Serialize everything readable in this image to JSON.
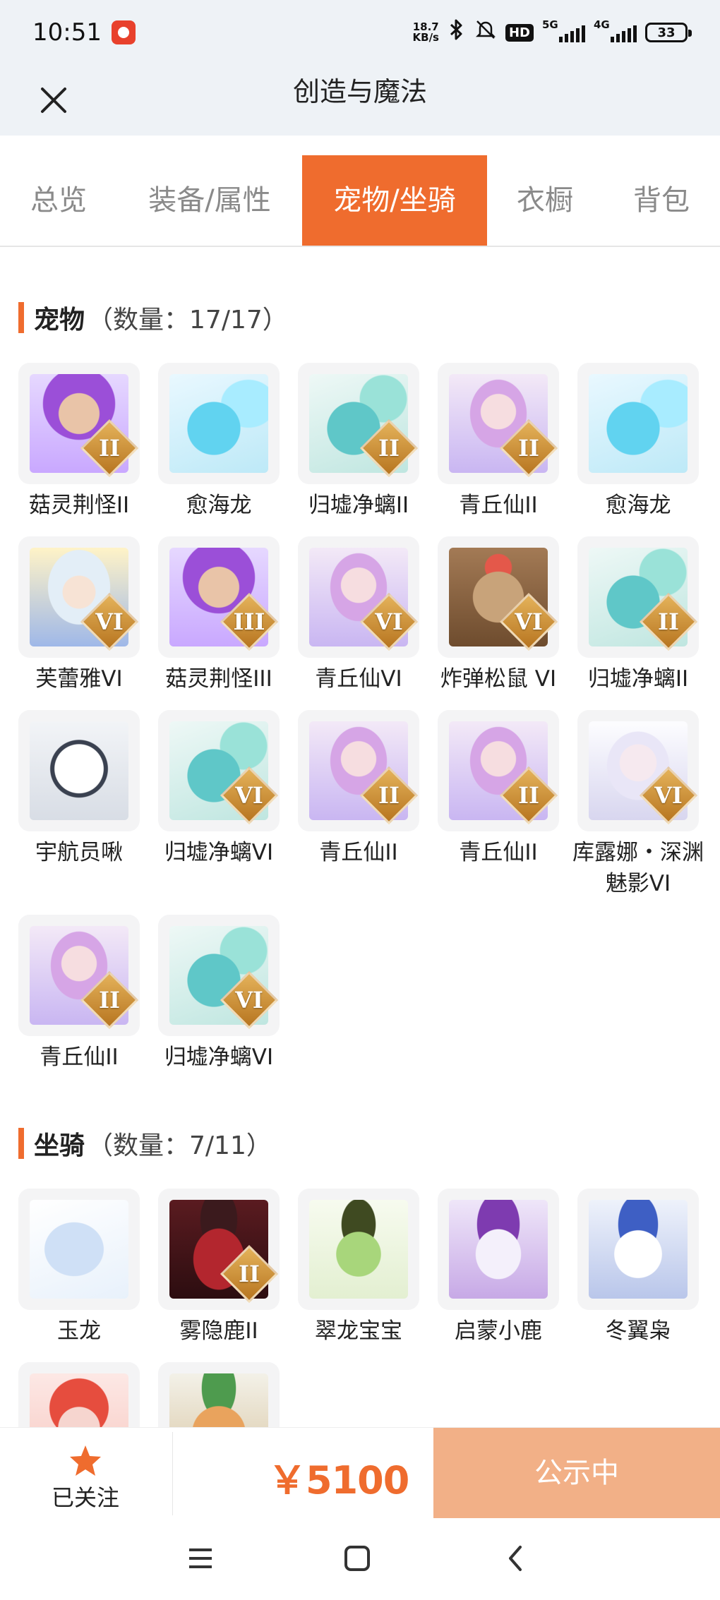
{
  "status_bar": {
    "time": "10:51",
    "net_speed_value": "18.7",
    "net_speed_unit": "KB/s",
    "hd_label": "HD",
    "signal_5g": "5G",
    "signal_4g": "4G",
    "battery": "33"
  },
  "header": {
    "title": "创造与魔法"
  },
  "tabs": [
    {
      "label": "总览"
    },
    {
      "label": "装备/属性"
    },
    {
      "label": "宠物/坐骑"
    },
    {
      "label": "衣橱"
    },
    {
      "label": "背包"
    }
  ],
  "pets": {
    "title": "宠物",
    "count": "（数量：17/17）",
    "items": [
      {
        "name": "菇灵荆怪II",
        "level": "II",
        "art": "mush"
      },
      {
        "name": "愈海龙",
        "level": "",
        "art": "haid"
      },
      {
        "name": "归墟净螭II",
        "level": "II",
        "art": "guix"
      },
      {
        "name": "青丘仙II",
        "level": "II",
        "art": "qing"
      },
      {
        "name": "愈海龙",
        "level": "",
        "art": "haid"
      },
      {
        "name": "芙蕾雅VI",
        "level": "VI",
        "art": "fule"
      },
      {
        "name": "菇灵荆怪III",
        "level": "III",
        "art": "mush"
      },
      {
        "name": "青丘仙VI",
        "level": "VI",
        "art": "qing"
      },
      {
        "name": "炸弹松鼠 VI",
        "level": "VI",
        "art": "song"
      },
      {
        "name": "归墟净螭II",
        "level": "II",
        "art": "guix"
      },
      {
        "name": "宇航员啾",
        "level": "",
        "art": "yuha"
      },
      {
        "name": "归墟净螭VI",
        "level": "VI",
        "art": "guix"
      },
      {
        "name": "青丘仙II",
        "level": "II",
        "art": "qing"
      },
      {
        "name": "青丘仙II",
        "level": "II",
        "art": "qing"
      },
      {
        "name": "库露娜・深渊魅影VI",
        "level": "VI",
        "art": "kulu"
      },
      {
        "name": "青丘仙II",
        "level": "II",
        "art": "qing"
      },
      {
        "name": "归墟净螭VI",
        "level": "VI",
        "art": "guix"
      }
    ]
  },
  "mounts": {
    "title": "坐骑",
    "count": "（数量：7/11）",
    "items": [
      {
        "name": "玉龙",
        "level": "",
        "art": "yulo"
      },
      {
        "name": "雾隐鹿II",
        "level": "II",
        "art": "wuyi"
      },
      {
        "name": "翠龙宝宝",
        "level": "",
        "art": "cuil"
      },
      {
        "name": "启蒙小鹿",
        "level": "",
        "art": "qime"
      },
      {
        "name": "冬翼枭",
        "level": "",
        "art": "dong"
      },
      {
        "name": "",
        "level": "",
        "art": "fox"
      },
      {
        "name": "",
        "level": "",
        "art": "dog"
      }
    ]
  },
  "bottom_bar": {
    "follow_label": "已关注",
    "price": "￥5100",
    "status_button": "公示中"
  },
  "colors": {
    "accent": "#ef6c2e",
    "status_button_bg": "#f2b087",
    "header_bg": "#eef2f6",
    "badge_gold": "#c98a2e"
  },
  "icons": {
    "close": "close-icon",
    "follow": "star-icon",
    "nav_menu": "menu-icon",
    "nav_home": "square-home-icon",
    "nav_back": "back-chevron-icon"
  }
}
